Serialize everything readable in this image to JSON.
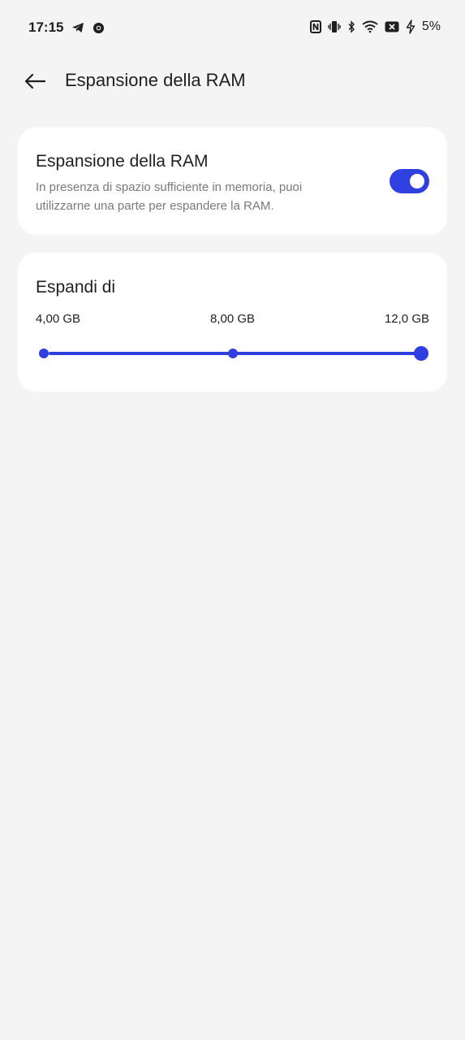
{
  "status_bar": {
    "time": "17:15",
    "left_icons": [
      "telegram-icon",
      "chrome-icon"
    ],
    "right_icons": [
      "nfc-icon",
      "vibrate-icon",
      "bluetooth-icon",
      "wifi-icon",
      "battery-icon",
      "charging-icon"
    ],
    "battery_percent": "5%"
  },
  "app_bar": {
    "back_icon": "arrow-back-icon",
    "title": "Espansione della RAM"
  },
  "ram_toggle": {
    "title": "Espansione della RAM",
    "description": "In presenza di spazio sufficiente in memoria, puoi utilizzarne una parte per espandere la RAM.",
    "enabled": true
  },
  "expand": {
    "title": "Espandi di",
    "options": [
      "4,00 GB",
      "8,00 GB",
      "12,0 GB"
    ],
    "selected_index": 2,
    "selected_value": "12,0 GB"
  },
  "colors": {
    "accent": "#2f3fe0",
    "background": "#f4f4f4",
    "card": "#ffffff",
    "secondary_text": "#7a7a7a"
  }
}
